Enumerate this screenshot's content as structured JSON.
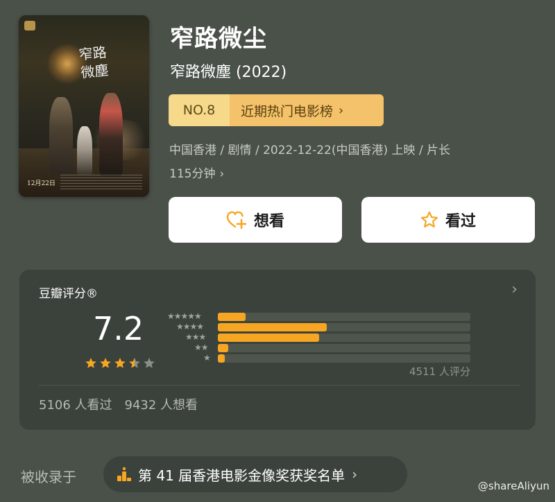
{
  "movie": {
    "title": "窄路微尘",
    "original_title": "窄路微塵 (2022)",
    "poster": {
      "calligraphy": "窄路微塵",
      "date": "12月22日"
    },
    "rank": {
      "number": "NO.8",
      "label": "近期热门电影榜"
    },
    "meta_line1": "中国香港 / 剧情 / 2022-12-22(中国香港) 上映 / 片长",
    "meta_line2": "115分钟"
  },
  "actions": {
    "want_label": "想看",
    "seen_label": "看过"
  },
  "rating": {
    "header": "豆瓣评分®",
    "score": "7.2",
    "stars_value": 3.5,
    "distribution": [
      {
        "stars": "★★★★★",
        "fraction": 0.11
      },
      {
        "stars": "★★★★",
        "fraction": 0.43
      },
      {
        "stars": "★★★",
        "fraction": 0.4
      },
      {
        "stars": "★★",
        "fraction": 0.04
      },
      {
        "stars": "★",
        "fraction": 0.02
      }
    ],
    "count_text": "4511 人评分",
    "seen_text": "5106 人看过",
    "want_text": "9432 人想看"
  },
  "included": {
    "label": "被收录于",
    "award": "第 41 届香港电影金像奖获奖名单"
  },
  "watermark": "@shareAliyun",
  "colors": {
    "background": "#4a5149",
    "card": "#3b423b",
    "accent_star": "#f6a623",
    "rank_left": "#f6d98a",
    "rank_right": "#f3c26a"
  }
}
